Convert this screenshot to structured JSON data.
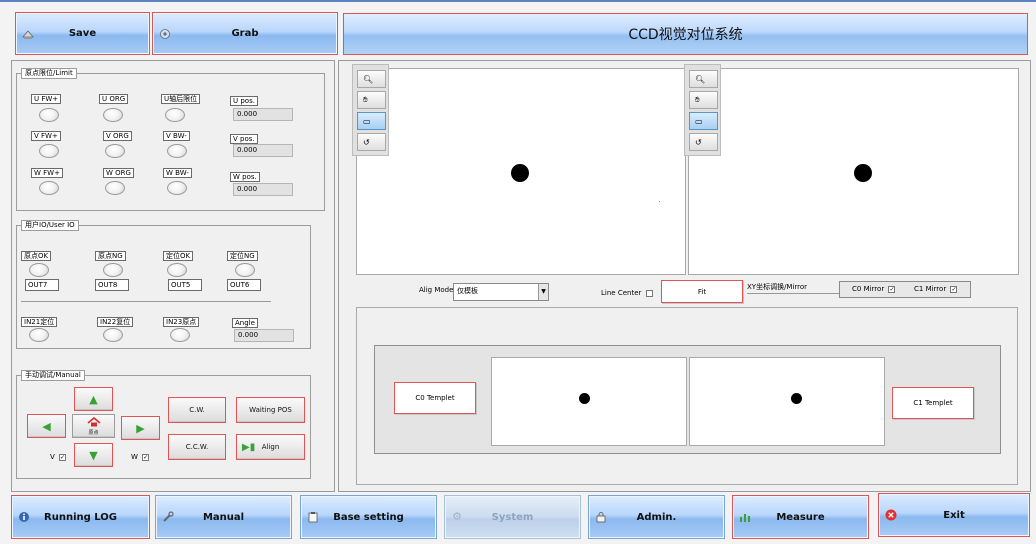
{
  "app": {
    "title": "CCD视觉对位系统"
  },
  "top_buttons": {
    "save": "Save",
    "grab": "Grab"
  },
  "limit_group": {
    "title": "原点限位/Limit",
    "u": {
      "fw": "U FW+",
      "org": "U ORG",
      "bw": "U轴后限位",
      "pos_label": "U pos.",
      "pos_value": "0.000"
    },
    "v": {
      "fw": "V FW+",
      "org": "V ORG",
      "bw": "V BW-",
      "pos_label": "V pos.",
      "pos_value": "0.000"
    },
    "w": {
      "fw": "W FW+",
      "org": "W ORG",
      "bw": "W BW-",
      "pos_label": "W pos.",
      "pos_value": "0.000"
    }
  },
  "io_group": {
    "title": "用户IO/User IO",
    "inputs": [
      "原点OK",
      "原点NG",
      "定位OK",
      "定位NG"
    ],
    "outputs": [
      "OUT7",
      "OUT8",
      "OUT5",
      "OUT6"
    ],
    "in_labels": [
      "IN21定位",
      "IN22复位",
      "IN23原点"
    ],
    "angle_label": "Angle",
    "angle_value": "0.000"
  },
  "manual_group": {
    "title": "手动调试/Manual",
    "home_caption": "原点",
    "cw": "C.W.",
    "ccw": "C.C.W.",
    "waiting_pos": "Waiting POS",
    "align": "Align",
    "v_label": "V",
    "w_label": "W"
  },
  "controls": {
    "alig_mode_label": "Alig Mode",
    "alig_mode_value": "仅模板",
    "line_center_label": "Line Center",
    "fit": "Fit",
    "xy_mirror": "XY坐标调换/Mirror",
    "c0_mirror": "C0  Mirror",
    "c1_mirror": "C1  Mirror"
  },
  "templets": {
    "c0": "C0  Templet",
    "c1": "C1  Templet"
  },
  "bottom_nav": {
    "running_log": "Running LOG",
    "manual": "Manual",
    "base_setting": "Base setting",
    "system": "System",
    "admin": "Admin.",
    "measure": "Measure",
    "exit": "Exit"
  },
  "icons": [
    "save-icon",
    "grab-icon",
    "zoom-icon",
    "hand-icon",
    "rectangle-icon",
    "rotate-icon",
    "arrow-up-icon",
    "arrow-left-icon",
    "arrow-right-icon",
    "arrow-down-icon",
    "home-icon",
    "align-icon",
    "info-icon",
    "wrench-icon",
    "clipboard-icon",
    "gear-icon",
    "lock-icon",
    "chart-icon",
    "close-icon"
  ],
  "colors": {
    "accent_border": "#e05454",
    "button_blue": "#a7cbf5",
    "arrow_green": "#38a238",
    "exit_red": "#e03030"
  }
}
